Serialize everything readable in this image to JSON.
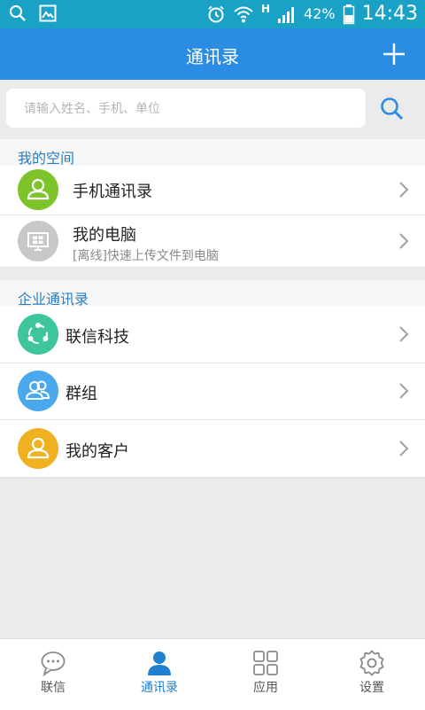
{
  "status_bar": {
    "network": "H",
    "battery": "42%",
    "time": "14:43"
  },
  "app_bar": {
    "title": "通讯录"
  },
  "search": {
    "placeholder": "请输入姓名、手机、单位"
  },
  "my_space": {
    "header": "我的空间",
    "items": [
      {
        "label": "手机通讯录"
      },
      {
        "label": "我的电脑",
        "sublabel": "[离线]快速上传文件到电脑"
      }
    ]
  },
  "enterprise": {
    "header": "企业通讯录",
    "items": [
      {
        "label": "联信科技"
      },
      {
        "label": "群组"
      },
      {
        "label": "我的客户"
      }
    ]
  },
  "tabs": [
    {
      "label": "联信",
      "icon": "chat-bubble-icon",
      "active": false
    },
    {
      "label": "通讯录",
      "icon": "contacts-person-icon",
      "active": true
    },
    {
      "label": "应用",
      "icon": "apps-grid-icon",
      "active": false
    },
    {
      "label": "设置",
      "icon": "settings-gear-icon",
      "active": false
    }
  ],
  "colors": {
    "status_bar": "#1aa1c6",
    "app_bar": "#2a8ce2",
    "section_header_text": "#2a7ec0",
    "phone_contacts_icon": "#7dc42b",
    "computer_icon": "#c8c8c8",
    "company_icon": "#3ec59b",
    "group_icon": "#4aa9ec",
    "customer_icon": "#f0b120",
    "active_tab": "#1f7fd0"
  }
}
